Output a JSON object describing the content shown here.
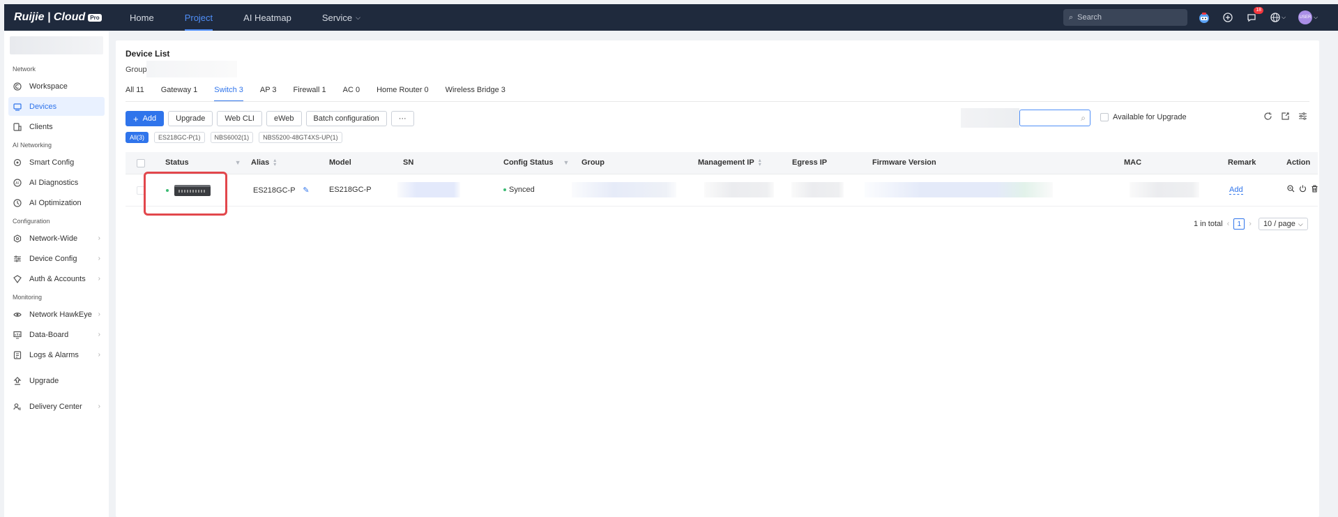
{
  "topbar": {
    "logo_text": "Ruijie | Cloud",
    "logo_badge": "Pro",
    "nav": [
      "Home",
      "Project",
      "AI Heatmap",
      "Service"
    ],
    "active_nav": "Project",
    "search_placeholder": "Search",
    "notification_count": "18",
    "avatar_text": "USER"
  },
  "sidebar": {
    "sections": [
      {
        "title": "Network",
        "items": [
          "Workspace",
          "Devices",
          "Clients"
        ]
      },
      {
        "title": "AI Networking",
        "items": [
          "Smart Config",
          "AI Diagnostics",
          "AI Optimization"
        ]
      },
      {
        "title": "Configuration",
        "items": [
          "Network-Wide",
          "Device Config",
          "Auth & Accounts"
        ]
      },
      {
        "title": "Monitoring",
        "items": [
          "Network HawkEye",
          "Data-Board",
          "Logs & Alarms"
        ]
      },
      {
        "title": "",
        "items": [
          "Upgrade",
          "Delivery Center"
        ]
      }
    ],
    "active_item": "Devices"
  },
  "main": {
    "title": "Device List",
    "group_label": "Group",
    "tabs": [
      "All 11",
      "Gateway 1",
      "Switch 3",
      "AP 3",
      "Firewall 1",
      "AC 0",
      "Home Router 0",
      "Wireless Bridge 3"
    ],
    "active_tab": "Switch 3",
    "toolbar": {
      "add": "Add",
      "upgrade": "Upgrade",
      "web_cli": "Web CLI",
      "eweb": "eWeb",
      "batch": "Batch configuration",
      "more": "···"
    },
    "available_for_upgrade": "Available for Upgrade",
    "chips": [
      "All(3)",
      "ES218GC-P(1)",
      "NBS6002(1)",
      "NBS5200-48GT4XS-UP(1)"
    ],
    "columns": {
      "status": "Status",
      "alias": "Alias",
      "model": "Model",
      "sn": "SN",
      "config_status": "Config Status",
      "group": "Group",
      "management_ip": "Management IP",
      "egress_ip": "Egress IP",
      "firmware_version": "Firmware Version",
      "mac": "MAC",
      "remark": "Remark",
      "action": "Action"
    },
    "row": {
      "alias": "ES218GC-P",
      "model": "ES218GC-P",
      "config_status": "Synced",
      "remark": "Add"
    },
    "pager": {
      "total": "1 in total",
      "page": "1",
      "per_page": "10 / page"
    }
  }
}
